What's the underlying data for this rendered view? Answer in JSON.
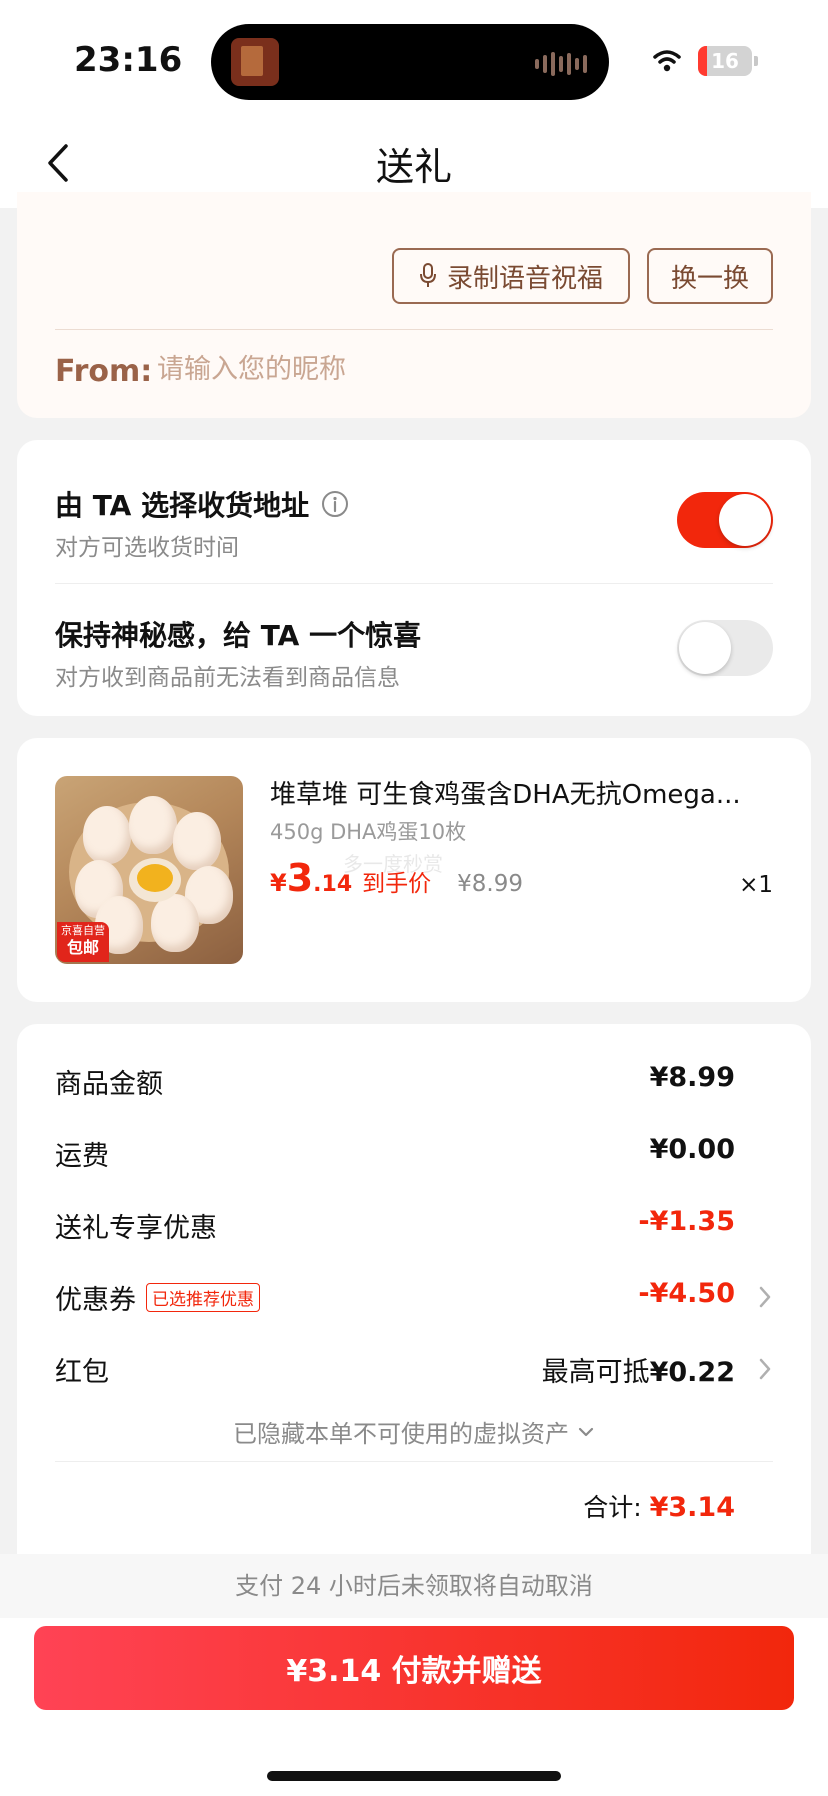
{
  "status_bar": {
    "time": "23:16",
    "battery": "16",
    "battery_level": 0.16
  },
  "nav": {
    "title": "送礼"
  },
  "greeting": {
    "record_label": "录制语音祝福",
    "swap_label": "换一换",
    "from_label": "From:",
    "from_placeholder": "请输入您的昵称"
  },
  "options": [
    {
      "title": "由 TA 选择收货地址",
      "subtitle": "对方可选收货时间",
      "on": true
    },
    {
      "title": "保持神秘感，给 TA 一个惊喜",
      "subtitle": "对方收到商品前无法看到商品信息",
      "on": false
    }
  ],
  "product": {
    "name": "堆草堆 可生食鸡蛋含DHA无抗Omega...",
    "spec": "450g DHA鸡蛋10枚",
    "price_currency": "¥",
    "price_int": "3",
    "price_dec": ".14",
    "price_tag": "到手价",
    "original_price": "¥8.99",
    "quantity": "×1",
    "badge_top": "京喜自营",
    "badge_bottom": "包邮",
    "watermark": "多一度秒赏"
  },
  "summary": {
    "rows": [
      {
        "label": "商品金额",
        "value": "¥8.99"
      },
      {
        "label": "运费",
        "value": "¥0.00"
      },
      {
        "label": "送礼专享优惠",
        "value": "-¥1.35"
      },
      {
        "label": "优惠券",
        "tag": "已选推荐优惠",
        "value": "-¥4.50"
      },
      {
        "label": "红包",
        "value_prefix": "最高可抵",
        "value": "¥0.22"
      }
    ],
    "hidden_assets": "已隐藏本单不可使用的虚拟资产",
    "total_label": "合计:",
    "total_value": "¥3.14"
  },
  "footer": {
    "notice": "支付 24 小时后未领取将自动取消",
    "pay_button": "¥3.14 付款并赠送"
  },
  "colors": {
    "accent": "#f2270c",
    "brown": "#9a6248"
  }
}
